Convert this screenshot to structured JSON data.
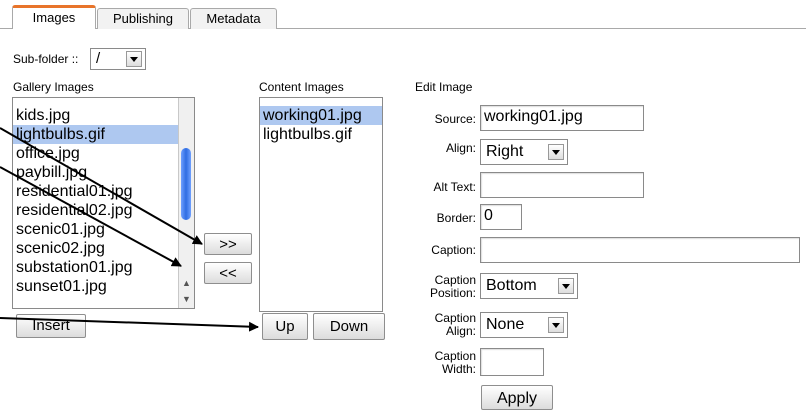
{
  "tabs": [
    "Images",
    "Publishing",
    "Metadata"
  ],
  "subfolder": {
    "label": "Sub-folder ::",
    "value": "/"
  },
  "gallery": {
    "label": "Gallery Images",
    "items": [
      "kids.jpg",
      "lightbulbs.gif",
      "office.jpg",
      "paybill.jpg",
      "residential01.jpg",
      "residential02.jpg",
      "scenic01.jpg",
      "scenic02.jpg",
      "substation01.jpg",
      "sunset01.jpg"
    ],
    "selected": "lightbulbs.gif",
    "insert_label": "Insert"
  },
  "mid_buttons": {
    "add": ">>",
    "remove": "<<"
  },
  "content": {
    "label": "Content Images",
    "items": [
      "working01.jpg",
      "lightbulbs.gif"
    ],
    "selected": "working01.jpg",
    "up_label": "Up",
    "down_label": "Down"
  },
  "edit": {
    "title": "Edit Image",
    "source_label": "Source:",
    "source_value": "working01.jpg",
    "align_label": "Align:",
    "align_value": "Right",
    "alt_label": "Alt Text:",
    "alt_value": "",
    "border_label": "Border:",
    "border_value": "0",
    "caption_label": "Caption:",
    "caption_value": "",
    "caption_position_label": "Caption Position:",
    "caption_position_line1": "Caption",
    "caption_position_line2": "Position:",
    "caption_position_value": "Bottom",
    "caption_align_line1": "Caption",
    "caption_align_line2": "Align:",
    "caption_align_value": "None",
    "caption_width_line1": "Caption",
    "caption_width_line2": "Width:",
    "caption_width_value": "",
    "apply_label": "Apply"
  }
}
